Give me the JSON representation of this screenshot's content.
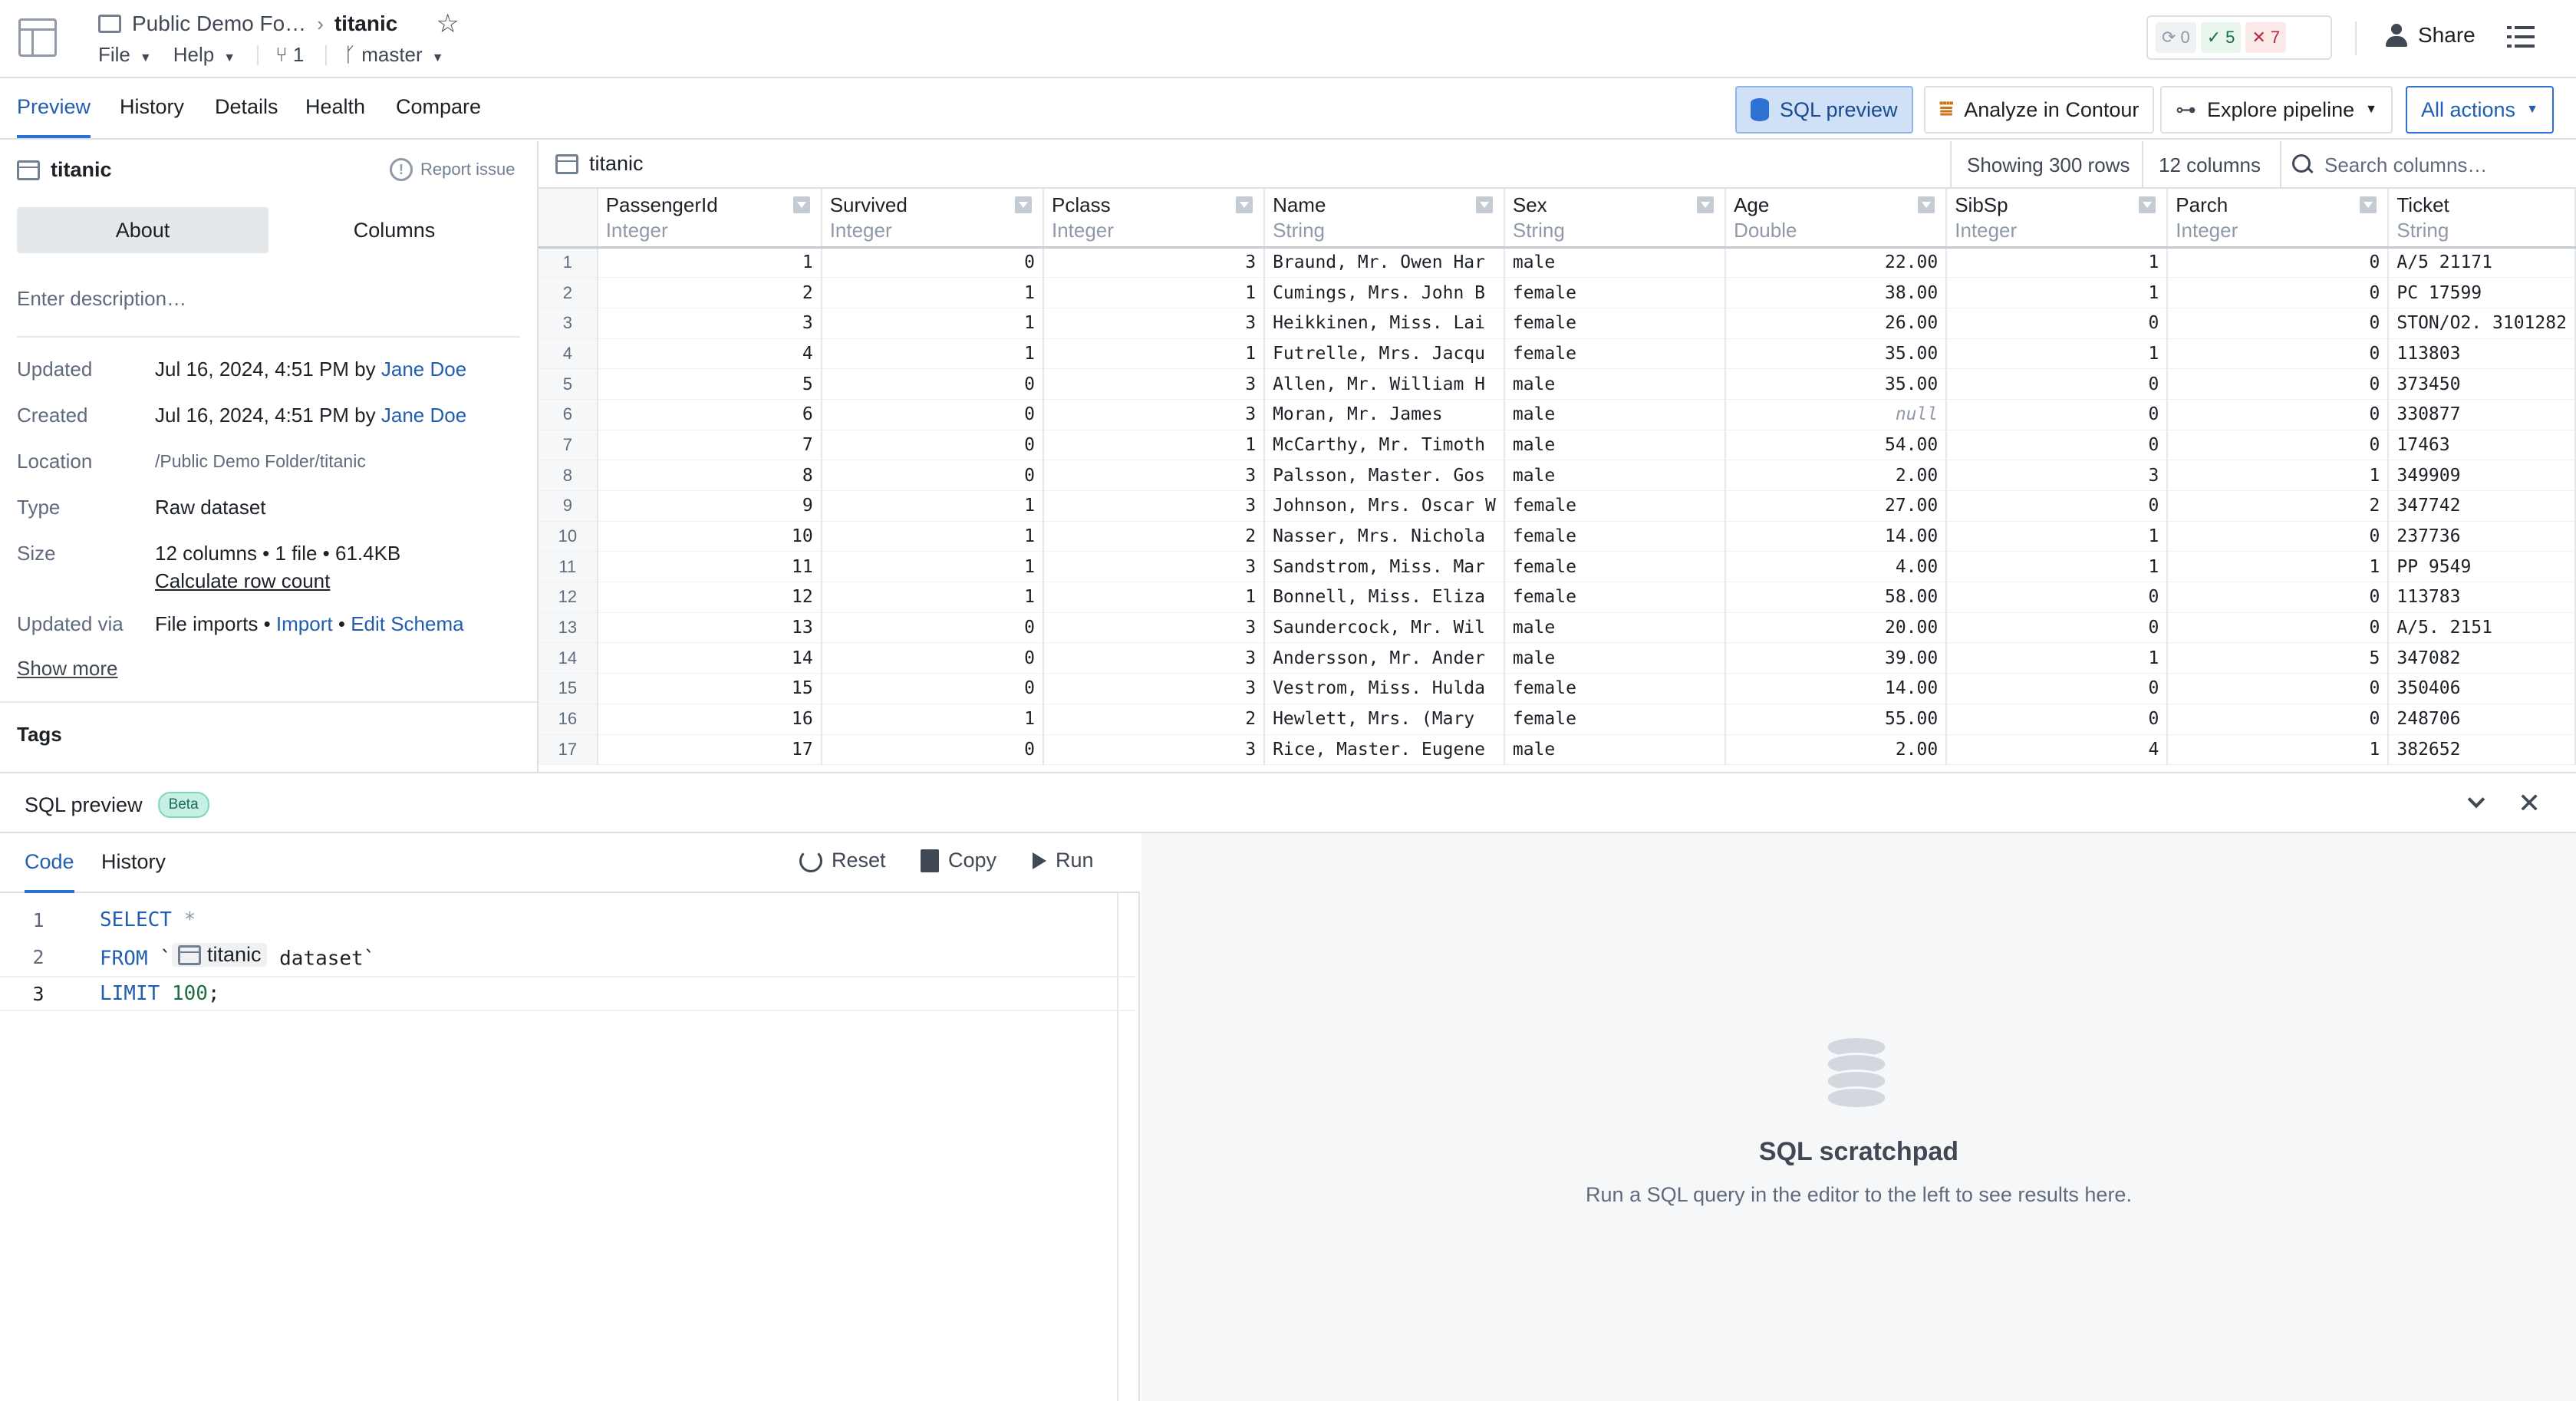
{
  "header": {
    "breadcrumb_folder": "Public Demo Fo…",
    "breadcrumb_current": "titanic",
    "menu_file": "File",
    "menu_help": "Help",
    "branch_count": "1",
    "branch_name": "master",
    "status_running": "0",
    "status_success": "5",
    "status_failed": "7",
    "share_label": "Share"
  },
  "tabs": [
    "Preview",
    "History",
    "Details",
    "Health",
    "Compare"
  ],
  "actions": {
    "sql_preview": "SQL preview",
    "analyze": "Analyze in Contour",
    "explore": "Explore pipeline",
    "all_actions": "All actions"
  },
  "left_panel": {
    "dataset_name": "titanic",
    "report_issue": "Report issue",
    "seg_about": "About",
    "seg_columns": "Columns",
    "description_placeholder": "Enter description…",
    "updated_label": "Updated",
    "updated_value": "Jul 16, 2024, 4:51 PM by",
    "updated_user": "Jane Doe",
    "created_label": "Created",
    "created_value": "Jul 16, 2024, 4:51 PM by",
    "created_user": "Jane Doe",
    "location_label": "Location",
    "location_value": "/Public Demo Folder/titanic",
    "type_label": "Type",
    "type_value": "Raw dataset",
    "size_label": "Size",
    "size_value": "12 columns • 1 file • 61.4KB",
    "calc_rows": "Calculate row count",
    "updated_via_label": "Updated via",
    "updated_via_value": "File imports •",
    "import_link": "Import",
    "bullet": "•",
    "edit_schema": "Edit Schema",
    "show_more": "Show more",
    "tags": "Tags"
  },
  "grid": {
    "title": "titanic",
    "showing": "Showing 300 rows",
    "columns_count": "12 columns",
    "search_placeholder": "Search columns…",
    "columns": [
      {
        "name": "PassengerId",
        "type": "Integer"
      },
      {
        "name": "Survived",
        "type": "Integer"
      },
      {
        "name": "Pclass",
        "type": "Integer"
      },
      {
        "name": "Name",
        "type": "String"
      },
      {
        "name": "Sex",
        "type": "String"
      },
      {
        "name": "Age",
        "type": "Double"
      },
      {
        "name": "SibSp",
        "type": "Integer"
      },
      {
        "name": "Parch",
        "type": "Integer"
      },
      {
        "name": "Ticket",
        "type": "String"
      }
    ],
    "rows": [
      [
        "1",
        "1",
        "0",
        "3",
        "Braund, Mr. Owen Har",
        "male",
        "22.00",
        "1",
        "0",
        "A/5 21171"
      ],
      [
        "2",
        "2",
        "1",
        "1",
        "Cumings, Mrs. John B",
        "female",
        "38.00",
        "1",
        "0",
        "PC 17599"
      ],
      [
        "3",
        "3",
        "1",
        "3",
        "Heikkinen, Miss. Lai",
        "female",
        "26.00",
        "0",
        "0",
        "STON/O2. 3101282"
      ],
      [
        "4",
        "4",
        "1",
        "1",
        "Futrelle, Mrs. Jacqu",
        "female",
        "35.00",
        "1",
        "0",
        "113803"
      ],
      [
        "5",
        "5",
        "0",
        "3",
        "Allen, Mr. William H",
        "male",
        "35.00",
        "0",
        "0",
        "373450"
      ],
      [
        "6",
        "6",
        "0",
        "3",
        "Moran, Mr. James",
        "male",
        "null",
        "0",
        "0",
        "330877"
      ],
      [
        "7",
        "7",
        "0",
        "1",
        "McCarthy, Mr. Timoth",
        "male",
        "54.00",
        "0",
        "0",
        "17463"
      ],
      [
        "8",
        "8",
        "0",
        "3",
        "Palsson, Master. Gos",
        "male",
        "2.00",
        "3",
        "1",
        "349909"
      ],
      [
        "9",
        "9",
        "1",
        "3",
        "Johnson, Mrs. Oscar W",
        "female",
        "27.00",
        "0",
        "2",
        "347742"
      ],
      [
        "10",
        "10",
        "1",
        "2",
        "Nasser, Mrs. Nichola",
        "female",
        "14.00",
        "1",
        "0",
        "237736"
      ],
      [
        "11",
        "11",
        "1",
        "3",
        "Sandstrom, Miss. Mar",
        "female",
        "4.00",
        "1",
        "1",
        "PP 9549"
      ],
      [
        "12",
        "12",
        "1",
        "1",
        "Bonnell, Miss. Eliza",
        "female",
        "58.00",
        "0",
        "0",
        "113783"
      ],
      [
        "13",
        "13",
        "0",
        "3",
        "Saundercock, Mr. Wil",
        "male",
        "20.00",
        "0",
        "0",
        "A/5. 2151"
      ],
      [
        "14",
        "14",
        "0",
        "3",
        "Andersson, Mr. Ander",
        "male",
        "39.00",
        "1",
        "5",
        "347082"
      ],
      [
        "15",
        "15",
        "0",
        "3",
        "Vestrom, Miss. Hulda",
        "female",
        "14.00",
        "0",
        "0",
        "350406"
      ],
      [
        "16",
        "16",
        "1",
        "2",
        "Hewlett, Mrs. (Mary",
        "female",
        "55.00",
        "0",
        "0",
        "248706"
      ],
      [
        "17",
        "17",
        "0",
        "3",
        "Rice, Master. Eugene",
        "male",
        "2.00",
        "4",
        "1",
        "382652"
      ]
    ]
  },
  "sql": {
    "title": "SQL preview",
    "beta": "Beta",
    "tab_code": "Code",
    "tab_history": "History",
    "reset": "Reset",
    "copy": "Copy",
    "run": "Run",
    "line1_kw": "SELECT",
    "line1_rest": "*",
    "line2_kw": "FROM",
    "line2_tick_open": "`",
    "line2_chip": "titanic",
    "line2_rest": "dataset`",
    "line3_kw": "LIMIT",
    "line3_num": "100",
    "line3_end": ";",
    "line_numbers": [
      "1",
      "2",
      "3"
    ],
    "scratch_title": "SQL scratchpad",
    "scratch_sub": "Run a SQL query in the editor to the left to see results here."
  }
}
